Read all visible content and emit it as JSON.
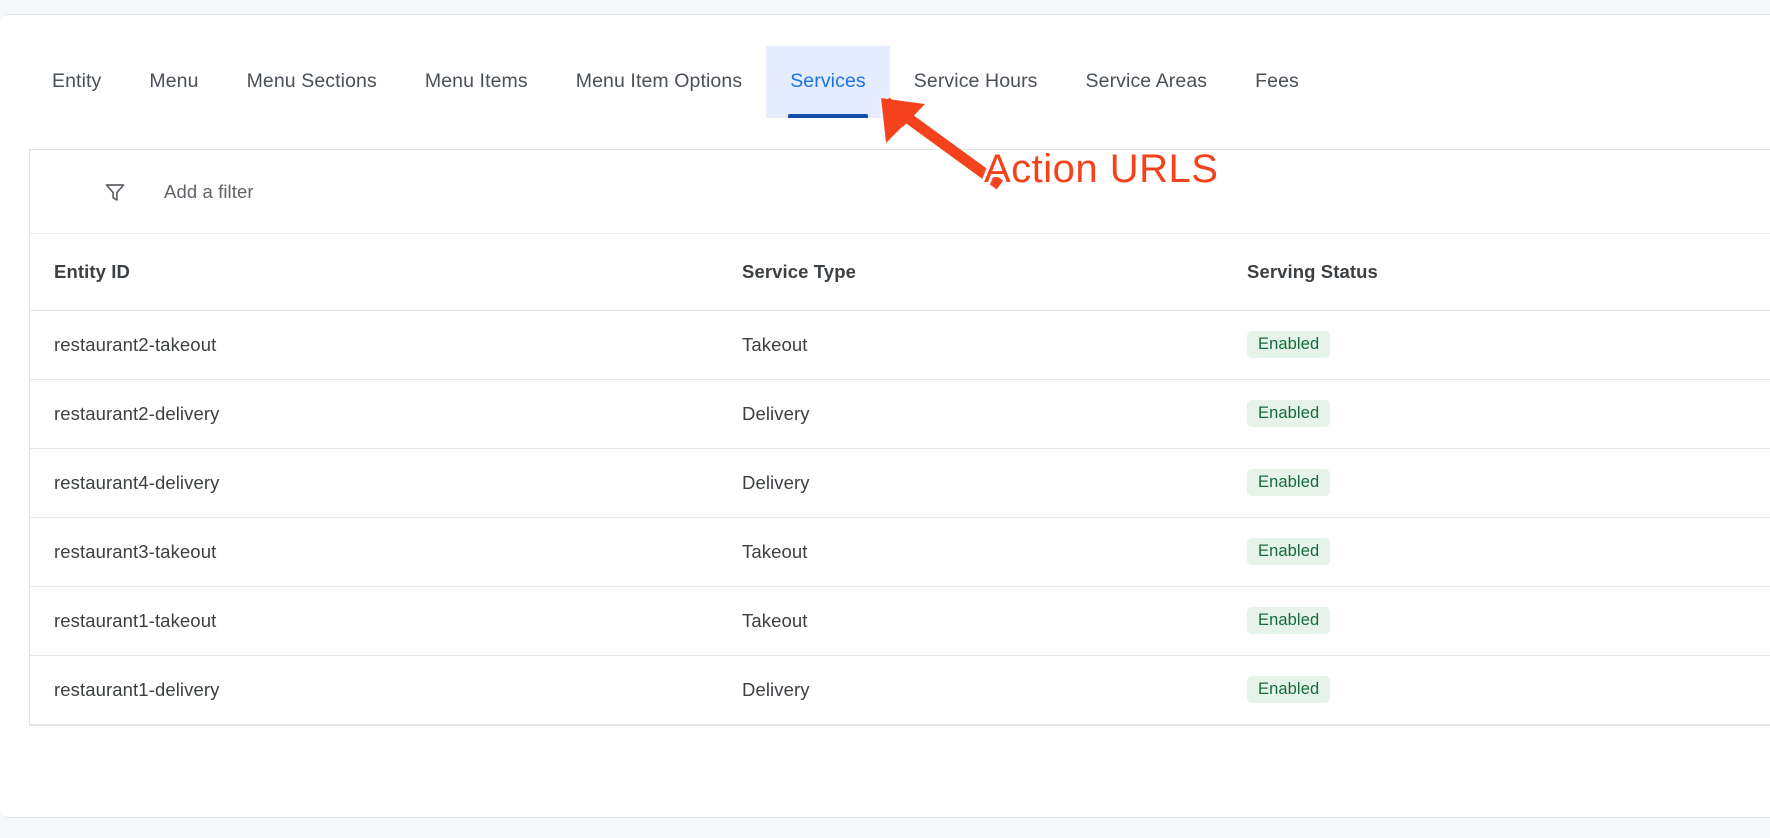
{
  "theme": {
    "page_background": "#f7f8f9",
    "card_background": "#ffffff",
    "accent_blue": "#1a73e8",
    "active_tab_background": "#e4ecfd",
    "active_tab_underline": "#174ea6",
    "badge_background": "#e5f3e9",
    "badge_text": "#18693a",
    "annotation_color": "#f4431c",
    "border": "#e4e6e9",
    "text_primary": "#3c4043",
    "text_secondary": "#5f6368"
  },
  "tabs": [
    {
      "label": "Entity",
      "active": false
    },
    {
      "label": "Menu",
      "active": false
    },
    {
      "label": "Menu Sections",
      "active": false
    },
    {
      "label": "Menu Items",
      "active": false
    },
    {
      "label": "Menu Item Options",
      "active": false
    },
    {
      "label": "Services",
      "active": true
    },
    {
      "label": "Service Hours",
      "active": false
    },
    {
      "label": "Service Areas",
      "active": false
    },
    {
      "label": "Fees",
      "active": false
    }
  ],
  "filter": {
    "icon": "filter-funnel-icon",
    "placeholder": "Add a filter",
    "value": ""
  },
  "table": {
    "columns": [
      {
        "key": "entity_id",
        "label": "Entity ID"
      },
      {
        "key": "service_type",
        "label": "Service Type"
      },
      {
        "key": "serving_status",
        "label": "Serving Status"
      }
    ],
    "rows": [
      {
        "entity_id": "restaurant2-takeout",
        "service_type": "Takeout",
        "serving_status": "Enabled"
      },
      {
        "entity_id": "restaurant2-delivery",
        "service_type": "Delivery",
        "serving_status": "Enabled"
      },
      {
        "entity_id": "restaurant4-delivery",
        "service_type": "Delivery",
        "serving_status": "Enabled"
      },
      {
        "entity_id": "restaurant3-takeout",
        "service_type": "Takeout",
        "serving_status": "Enabled"
      },
      {
        "entity_id": "restaurant1-takeout",
        "service_type": "Takeout",
        "serving_status": "Enabled"
      },
      {
        "entity_id": "restaurant1-delivery",
        "service_type": "Delivery",
        "serving_status": "Enabled"
      }
    ]
  },
  "annotation": {
    "label": "Action URLS",
    "arrow": "arrow-pointing-up-left",
    "points_to": "Services"
  }
}
